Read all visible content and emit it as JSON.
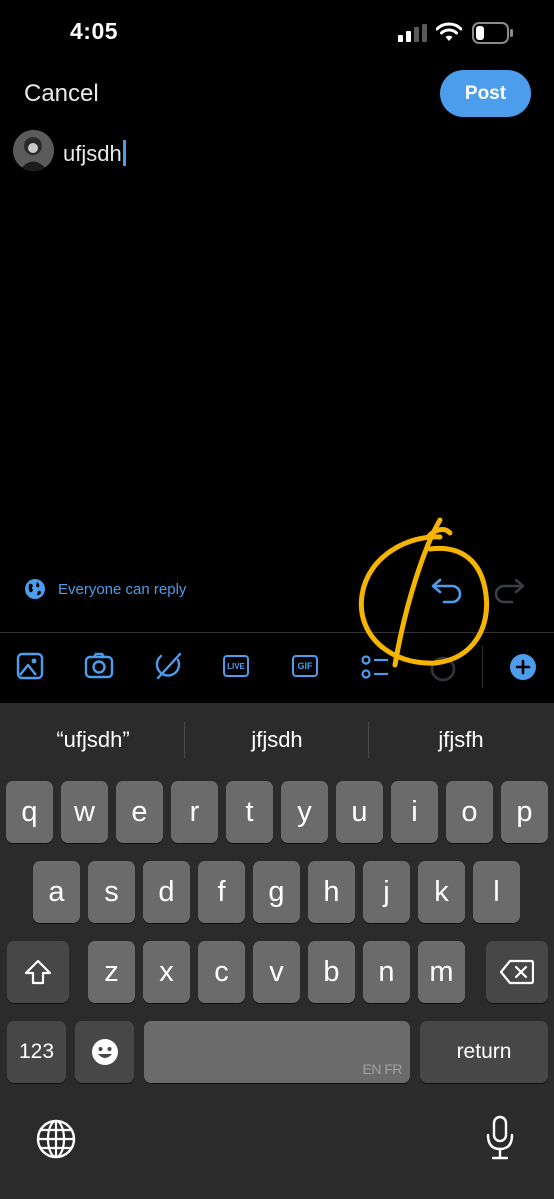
{
  "status_bar": {
    "time": "4:05"
  },
  "header": {
    "cancel_label": "Cancel",
    "post_label": "Post"
  },
  "compose": {
    "text": "ufjsdh"
  },
  "reply_settings": {
    "label": "Everyone can reply"
  },
  "toolbar": {
    "items": [
      {
        "icon": "image-icon"
      },
      {
        "icon": "camera-icon"
      },
      {
        "icon": "nft-icon"
      },
      {
        "icon": "live-icon",
        "label": "LIVE"
      },
      {
        "icon": "gif-icon",
        "label": "GIF"
      },
      {
        "icon": "poll-icon"
      },
      {
        "icon": "char-progress-icon"
      },
      {
        "icon": "add-thread-icon"
      }
    ]
  },
  "keyboard": {
    "suggestions": [
      "“ufjsdh”",
      "jfjsdh",
      "jfjsfh"
    ],
    "row1": [
      "q",
      "w",
      "e",
      "r",
      "t",
      "y",
      "u",
      "i",
      "o",
      "p"
    ],
    "row2": [
      "a",
      "s",
      "d",
      "f",
      "g",
      "h",
      "j",
      "k",
      "l"
    ],
    "row3": [
      "z",
      "x",
      "c",
      "v",
      "b",
      "n",
      "m"
    ],
    "numbers_label": "123",
    "return_label": "return",
    "space_lang": "EN FR"
  },
  "colors": {
    "accent": "#4c9deb",
    "annotation": "#f5b400",
    "keyboard_bg": "#2b2b2b",
    "key": "#6b6b6b",
    "key_dark": "#474747"
  }
}
